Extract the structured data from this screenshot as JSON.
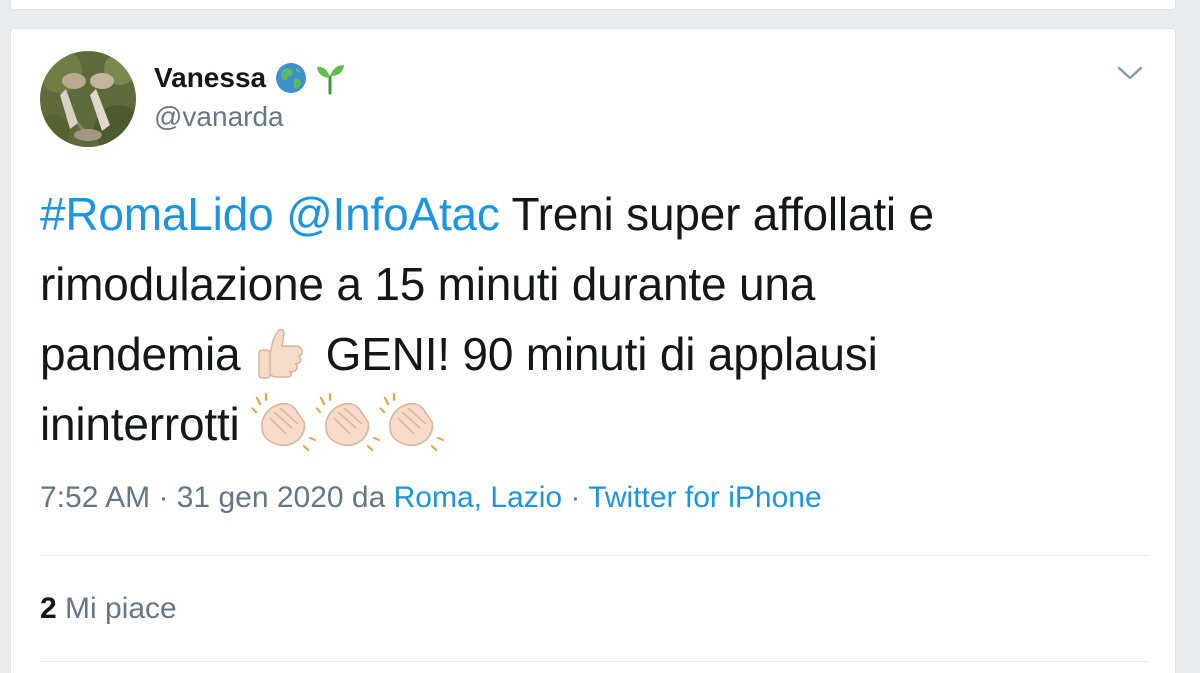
{
  "tweet": {
    "author": {
      "display_name": "Vanessa",
      "handle": "@vanarda",
      "name_icons": [
        "globe-icon",
        "sprout-icon"
      ]
    },
    "text": {
      "hashtag": "#RomaLido",
      "mention": "@InfoAtac",
      "line1_rest": " Treni super affollati e",
      "line2": "rimodulazione a 15 minuti durante una",
      "line3_start": "pandemia ",
      "line3_end": " GENI! 90 minuti di applausi",
      "line4": "ininterrotti "
    },
    "meta": {
      "time": "7:52 AM",
      "sep1": " · ",
      "date": "31 gen 2020",
      "da": " da ",
      "location": "Roma, Lazio",
      "sep2": " · ",
      "source": "Twitter for iPhone"
    },
    "stats": {
      "likes_count": "2",
      "likes_label": "Mi piace"
    }
  },
  "colors": {
    "link": "#1b95e0",
    "secondary_text": "#657786",
    "primary_text": "#14171a",
    "background": "#e6ecf0"
  }
}
